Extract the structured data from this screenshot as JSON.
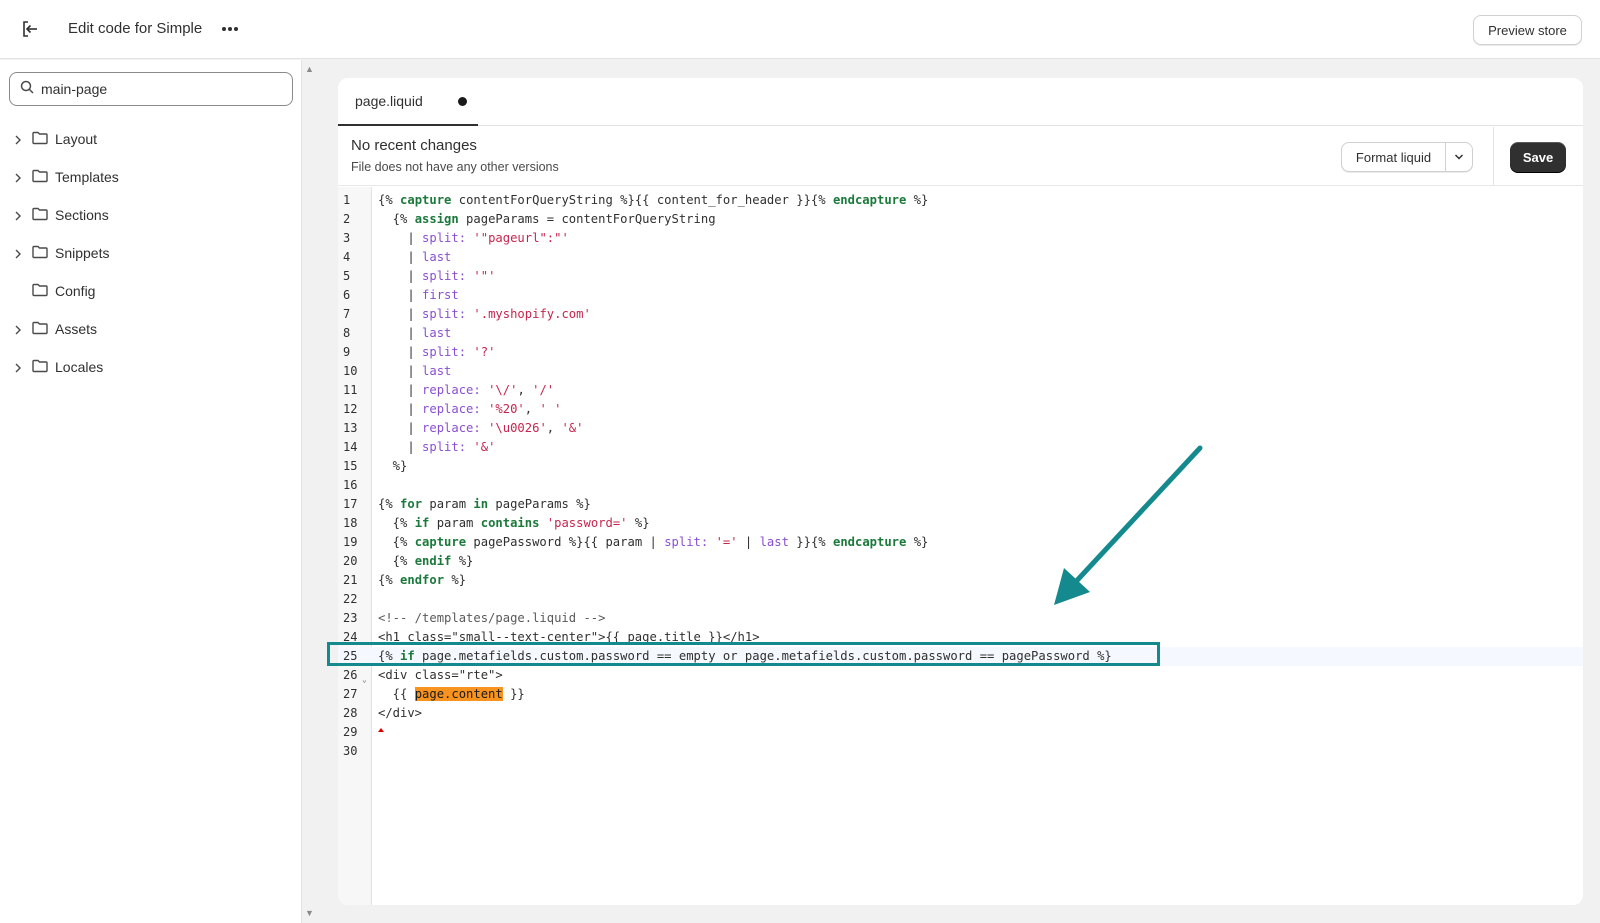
{
  "header": {
    "title": "Edit code for Simple",
    "preview_label": "Preview store"
  },
  "sidebar": {
    "search_value": "main-page",
    "items": [
      {
        "label": "Layout",
        "expandable": true
      },
      {
        "label": "Templates",
        "expandable": true
      },
      {
        "label": "Sections",
        "expandable": true
      },
      {
        "label": "Snippets",
        "expandable": true
      },
      {
        "label": "Config",
        "expandable": false
      },
      {
        "label": "Assets",
        "expandable": true
      },
      {
        "label": "Locales",
        "expandable": true
      }
    ]
  },
  "editor": {
    "tab_label": "page.liquid",
    "tab_unsaved": true,
    "version_title": "No recent changes",
    "version_subtitle": "File does not have any other versions",
    "format_label": "Format liquid",
    "save_label": "Save",
    "active_line": 25,
    "lines": [
      {
        "n": "1",
        "code": "{% capture contentForQueryString %}{{ content_for_header }}{% endcapture %}"
      },
      {
        "n": "2",
        "code": "  {% assign pageParams = contentForQueryString"
      },
      {
        "n": "3",
        "code": "    | split: '\"pageurl\":\"'"
      },
      {
        "n": "4",
        "code": "    | last"
      },
      {
        "n": "5",
        "code": "    | split: '\"'"
      },
      {
        "n": "6",
        "code": "    | first"
      },
      {
        "n": "7",
        "code": "    | split: '.myshopify.com'"
      },
      {
        "n": "8",
        "code": "    | last"
      },
      {
        "n": "9",
        "code": "    | split: '?'"
      },
      {
        "n": "10",
        "code": "    | last"
      },
      {
        "n": "11",
        "code": "    | replace: '\\/', '/'"
      },
      {
        "n": "12",
        "code": "    | replace: '%20', ' '"
      },
      {
        "n": "13",
        "code": "    | replace: '\\u0026', '&'"
      },
      {
        "n": "14",
        "code": "    | split: '&'"
      },
      {
        "n": "15",
        "code": "  %}"
      },
      {
        "n": "16",
        "code": ""
      },
      {
        "n": "17",
        "code": "{% for param in pageParams %}"
      },
      {
        "n": "18",
        "code": "  {% if param contains 'password=' %}"
      },
      {
        "n": "19",
        "code": "  {% capture pagePassword %}{{ param | split: '=' | last }}{% endcapture %}"
      },
      {
        "n": "20",
        "code": "  {% endif %}"
      },
      {
        "n": "21",
        "code": "{% endfor %}"
      },
      {
        "n": "22",
        "code": ""
      },
      {
        "n": "23",
        "code": "<!-- /templates/page.liquid -->"
      },
      {
        "n": "24",
        "code": "<h1 class=\"small--text-center\">{{ page.title }}</h1>"
      },
      {
        "n": "25",
        "code": "{% if page.metafields.custom.password == empty or page.metafields.custom.password == pagePassword %}"
      },
      {
        "n": "26",
        "code": "<div class=\"rte\">"
      },
      {
        "n": "27",
        "code": "  {{ page.content }}"
      },
      {
        "n": "28",
        "code": "</div>"
      },
      {
        "n": "29",
        "code": ""
      },
      {
        "n": "30",
        "code": ""
      }
    ]
  },
  "colors": {
    "annotation": "#148a8f",
    "save_bg": "#303030",
    "highlight": "#f7931e"
  }
}
